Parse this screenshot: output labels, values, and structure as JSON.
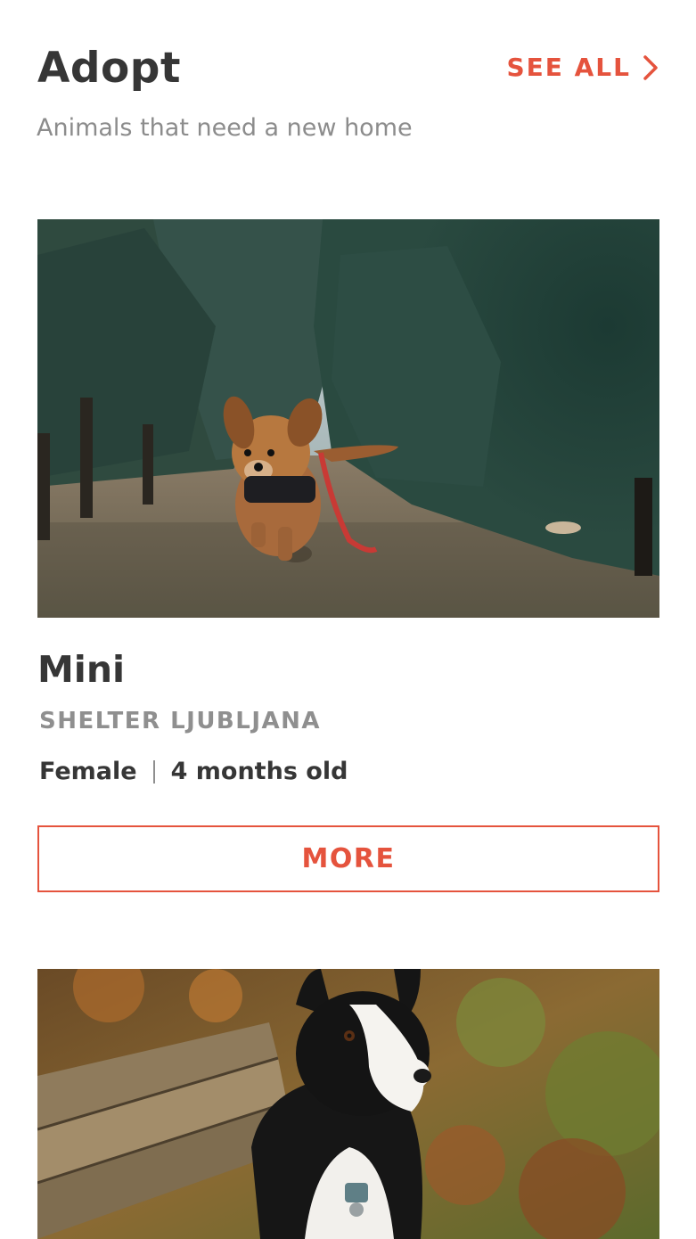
{
  "header": {
    "title": "Adopt",
    "subtitle": "Animals that need a new home",
    "see_all_label": "SEE ALL"
  },
  "pets": [
    {
      "name": "Mini",
      "shelter": "SHELTER LJUBLJANA",
      "gender": "Female",
      "age": "4 months old",
      "more_label": "MORE",
      "photo_description_icon": "puppy-photo"
    },
    {
      "photo_description_icon": "border-collie-photo"
    }
  ],
  "colors": {
    "accent": "#e5533d",
    "text_primary": "#363636",
    "text_secondary": "#8f8f8f"
  }
}
